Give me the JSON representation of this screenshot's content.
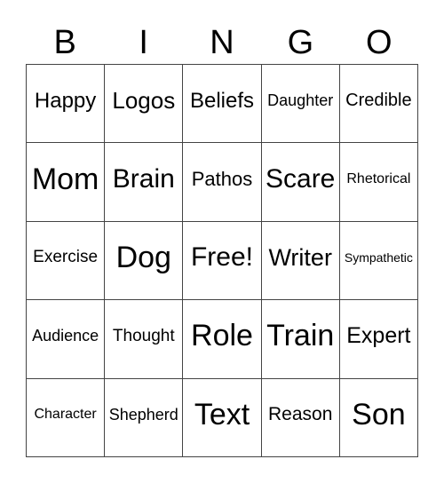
{
  "header": [
    "B",
    "I",
    "N",
    "G",
    "O"
  ],
  "cells": [
    "Happy",
    "Logos",
    "Beliefs",
    "Daughter",
    "Credible",
    "Mom",
    "Brain",
    "Pathos",
    "Scare",
    "Rhetorical",
    "Exercise",
    "Dog",
    "Free!",
    "Writer",
    "Sympathetic",
    "Audience",
    "Thought",
    "Role",
    "Train",
    "Expert",
    "Character",
    "Shepherd",
    "Text",
    "Reason",
    "Son"
  ]
}
